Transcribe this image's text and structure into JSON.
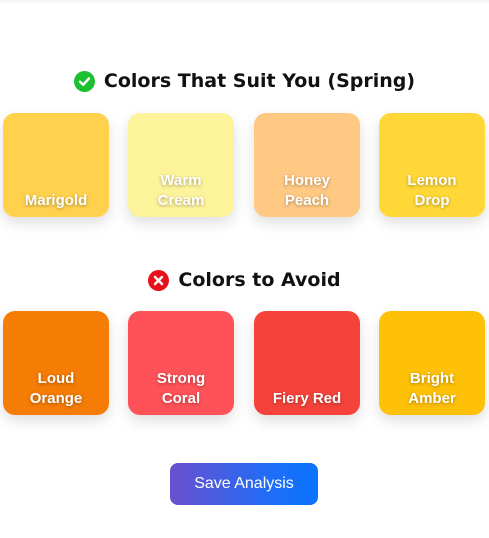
{
  "suit_section": {
    "title": "Colors That Suit You (Spring)",
    "icon": "check-circle-icon",
    "icon_color": "#1bbf2f",
    "swatches": [
      {
        "label": "Marigold",
        "color": "#ffd14d"
      },
      {
        "label": "Warm\nCream",
        "color": "#fdf39a"
      },
      {
        "label": "Honey\nPeach",
        "color": "#ffc983"
      },
      {
        "label": "Lemon\nDrop",
        "color": "#ffd837"
      }
    ]
  },
  "avoid_section": {
    "title": "Colors to Avoid",
    "icon": "x-circle-icon",
    "icon_color": "#e8101b",
    "swatches": [
      {
        "label": "Loud\nOrange",
        "color": "#f57c05"
      },
      {
        "label": "Strong\nCoral",
        "color": "#ff5258"
      },
      {
        "label": "Fiery Red",
        "color": "#f5433b"
      },
      {
        "label": "Bright\nAmber",
        "color": "#ffc107"
      }
    ]
  },
  "actions": {
    "save_label": "Save Analysis"
  }
}
